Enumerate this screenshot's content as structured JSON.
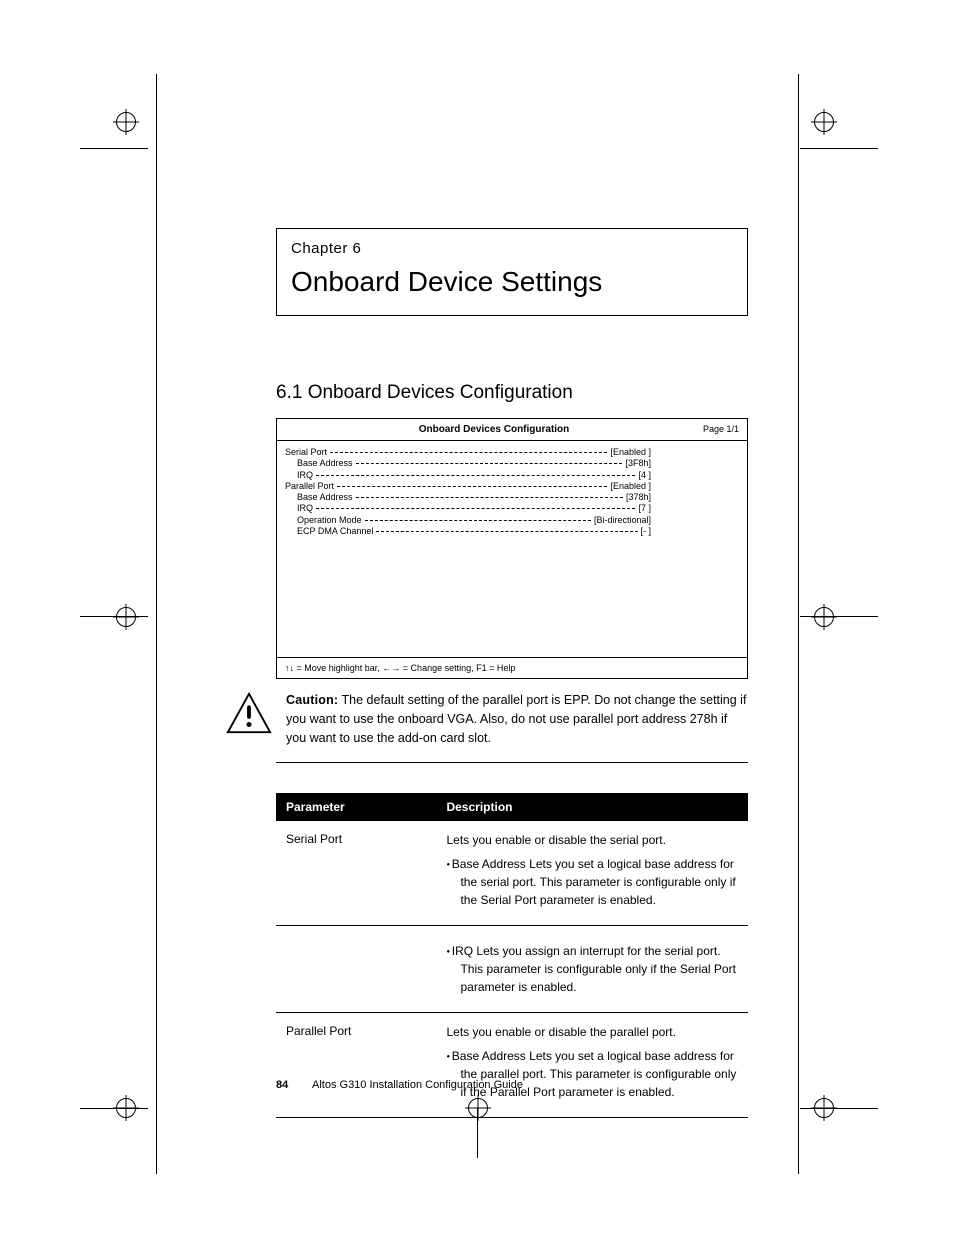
{
  "chapter": {
    "label": "Chapter 6",
    "title": "Onboard Device Settings"
  },
  "section": {
    "heading": "6.1 Onboard Devices Configuration"
  },
  "bios": {
    "title": "Onboard Devices Configuration",
    "page": "Page 1/1",
    "rows": [
      {
        "indent": false,
        "label": "Serial Port",
        "value": "[Enabled ]"
      },
      {
        "indent": true,
        "label": "Base Address",
        "value": "[3F8h]"
      },
      {
        "indent": true,
        "label": "IRQ",
        "value": "[4 ]"
      },
      {
        "indent": false,
        "label": "Parallel Port",
        "value": "[Enabled ]"
      },
      {
        "indent": true,
        "label": "Base Address",
        "value": "[378h]"
      },
      {
        "indent": true,
        "label": "IRQ",
        "value": "[7 ]"
      },
      {
        "indent": true,
        "label": "Operation Mode",
        "value": "[Bi-directional]"
      },
      {
        "indent": true,
        "label": "ECP DMA Channel",
        "value": "[- ]"
      }
    ],
    "help": "↑↓ = Move highlight bar, ←→ = Change setting, F1 = Help"
  },
  "caution": {
    "lead": "Caution:",
    "body": "The default setting of the parallel port is EPP. Do not change the setting if you want to use the onboard VGA. Also, do not use parallel port address 278h if you want to use the add-on card slot."
  },
  "table": {
    "headers": {
      "param": "Parameter",
      "desc": "Description"
    },
    "rows": [
      {
        "param": "Serial Port",
        "desc": "Lets you enable or disable the serial port.",
        "sub": "Base Address  Lets you set a logical base address for the serial port. This parameter is configurable only if the Serial Port parameter is enabled."
      },
      {
        "param": "",
        "desc": "",
        "sub": "IRQ  Lets you assign an interrupt for the serial port. This parameter is configurable only if the Serial Port parameter is enabled."
      },
      {
        "param": "Parallel Port",
        "desc": "Lets you enable or disable the parallel port.",
        "sub": "Base Address  Lets you set a logical base address for the parallel port. This parameter is configurable only if the Parallel Port parameter is enabled."
      }
    ]
  },
  "footer": {
    "page": "84",
    "title": "Altos G310 Installation Configuration Guide"
  }
}
